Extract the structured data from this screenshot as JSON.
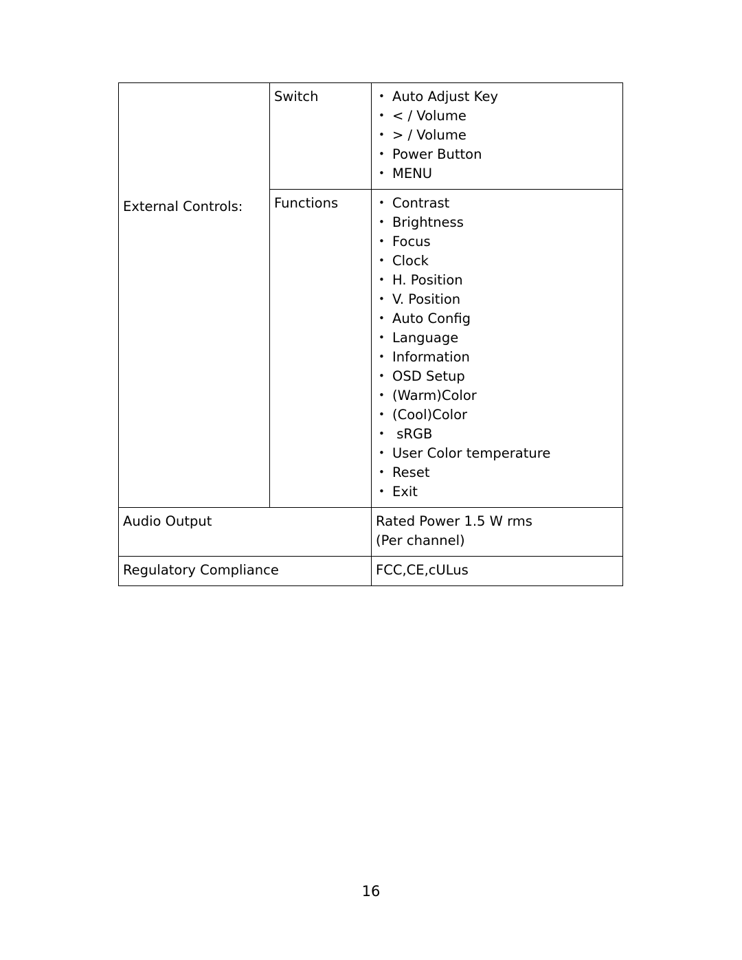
{
  "document": {
    "page_number": "16",
    "table": {
      "rows": [
        {
          "label": "",
          "sublabel": "Switch",
          "items": [
            "Auto Adjust Key",
            "< / Volume",
            "> / Volume",
            "Power Button",
            "MENU"
          ]
        },
        {
          "label": "External Controls:",
          "sublabel": "Functions",
          "items": [
            "Contrast",
            "Brightness",
            "Focus",
            "Clock",
            "H. Position",
            "V. Position",
            "Auto Config",
            "Language",
            "Information",
            "OSD Setup",
            "(Warm)Color",
            "(Cool)Color",
            " sRGB",
            "User Color temperature",
            "Reset",
            "Exit"
          ]
        },
        {
          "label": "Audio Output",
          "value_lines": [
            "Rated Power 1.5 W rms",
            "(Per channel)"
          ]
        },
        {
          "label": "Regulatory Compliance",
          "value_lines": [
            "FCC,CE,cULus"
          ]
        }
      ]
    }
  }
}
